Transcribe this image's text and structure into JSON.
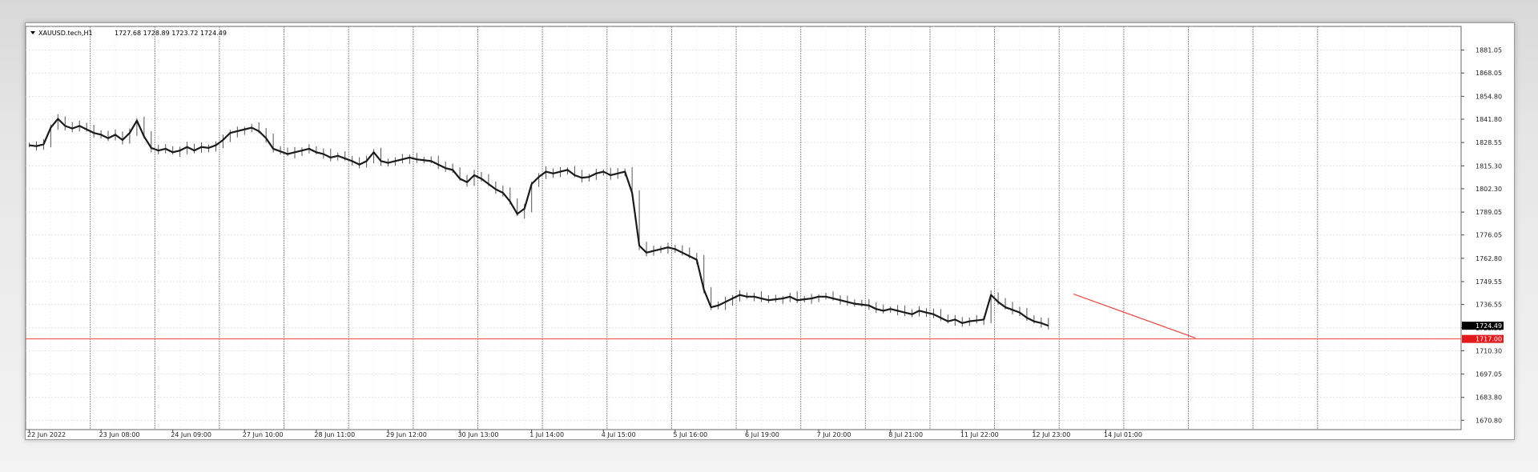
{
  "symbol_header": {
    "symbol": "XAUUSD.tech,H1",
    "ohlc": "1727.68 1728.89 1723.72 1724.49"
  },
  "chart_data": {
    "type": "line",
    "title": "",
    "xlabel": "",
    "ylabel": "",
    "x_tick_labels": [
      "22 Jun 2022",
      "23 Jun 08:00",
      "24 Jun 09:00",
      "27 Jun 10:00",
      "28 Jun 11:00",
      "29 Jun 12:00",
      "30 Jun 13:00",
      "1 Jul 14:00",
      "4 Jul 15:00",
      "5 Jul 16:00",
      "6 Jul 19:00",
      "7 Jul 20:00",
      "8 Jul 21:00",
      "11 Jul 22:00",
      "12 Jul 23:00",
      "14 Jul 01:00"
    ],
    "y_tick_labels": [
      "1881.05",
      "1868.05",
      "1854.80",
      "1841.80",
      "1828.55",
      "1815.30",
      "1802.30",
      "1789.05",
      "1776.05",
      "1762.80",
      "1749.55",
      "1736.55",
      "1723.30",
      "1710.30",
      "1697.05",
      "1683.80",
      "1670.80"
    ],
    "ylim": [
      1665.5,
      1894.5
    ],
    "series": [
      {
        "values": [
          1827,
          1826.5,
          1827.5,
          1837,
          1842,
          1838,
          1836.5,
          1838,
          1836,
          1834,
          1833,
          1831,
          1833,
          1830,
          1834,
          1841,
          1832,
          1825.5,
          1824,
          1825,
          1823,
          1824,
          1826,
          1824,
          1826,
          1825.5,
          1827,
          1830,
          1834,
          1835,
          1836,
          1837,
          1835,
          1831,
          1825,
          1823.5,
          1822,
          1823,
          1824,
          1825,
          1823,
          1822,
          1820,
          1821,
          1819.5,
          1818,
          1816,
          1818,
          1823,
          1818,
          1817,
          1818,
          1819,
          1820,
          1819,
          1818.5,
          1818,
          1816,
          1814,
          1813,
          1808,
          1806,
          1810,
          1808,
          1805,
          1802,
          1800,
          1795,
          1788,
          1791,
          1805,
          1809,
          1812,
          1811,
          1812,
          1813,
          1810,
          1808.5,
          1809,
          1811,
          1812,
          1810,
          1811,
          1812,
          1800,
          1770,
          1766,
          1767,
          1768,
          1769,
          1768,
          1766,
          1764,
          1762,
          1745,
          1735,
          1736,
          1738,
          1740,
          1742,
          1741,
          1741,
          1740,
          1739,
          1739.5,
          1740,
          1741,
          1739,
          1739.5,
          1740,
          1741,
          1741,
          1740,
          1739,
          1738,
          1737,
          1736.5,
          1736,
          1734,
          1733,
          1734,
          1733,
          1732,
          1731,
          1733,
          1732,
          1731,
          1729,
          1727,
          1728,
          1726,
          1727,
          1727.5,
          1728,
          1742,
          1738,
          1735,
          1733.5,
          1732,
          1729,
          1727,
          1726,
          1724.5
        ]
      }
    ],
    "trendline": {
      "from": [
        145.5,
        1742.5
      ],
      "to": [
        162.5,
        1717.5
      ]
    },
    "horizontal_line": 1717.0,
    "price_labels": [
      {
        "label": "1724.49",
        "value": 1724.5,
        "color": "#000000"
      },
      {
        "label": "1717.00",
        "value": 1717.0,
        "color": "#e31a1c"
      }
    ],
    "grid": true,
    "colors": {
      "price": "#1a1a1a",
      "line": "#e8473f",
      "grid": "#e4e4e4",
      "separator": "#8c8c8c"
    }
  }
}
